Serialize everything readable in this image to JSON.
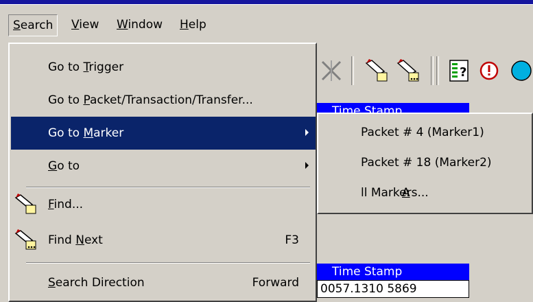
{
  "menubar": {
    "items": [
      {
        "label": "Search",
        "open": true
      },
      {
        "label": "View"
      },
      {
        "label": "Window"
      },
      {
        "label": "Help"
      }
    ]
  },
  "search_menu": {
    "items": [
      {
        "label": "Go to Trigger"
      },
      {
        "label": "Go to Packet/Transaction/Transfer..."
      },
      {
        "label": "Go to Marker",
        "submenu": true,
        "highlighted": true
      },
      {
        "label": "Go to",
        "submenu": true
      },
      {
        "label": "Find...",
        "icon": "flashlight-icon"
      },
      {
        "label": "Find Next",
        "icon": "flashlight-next-icon",
        "shortcut": "F3"
      },
      {
        "label": "Search Direction",
        "value": "Forward"
      }
    ]
  },
  "marker_submenu": {
    "items": [
      {
        "label": "Packet # 4 (Marker1)"
      },
      {
        "label": "Packet # 18 (Marker2)"
      },
      {
        "label": "All Markers..."
      }
    ]
  },
  "background": {
    "timestamp_header_top": "Time Stamp",
    "timestamp_header": "Time Stamp",
    "timestamp_value": "0057.1310 5869"
  },
  "colors": {
    "menu_bg": "#d4d0c8",
    "highlight": "#0a246a",
    "header_blue": "#0000ff",
    "title_blue": "#15159e"
  }
}
